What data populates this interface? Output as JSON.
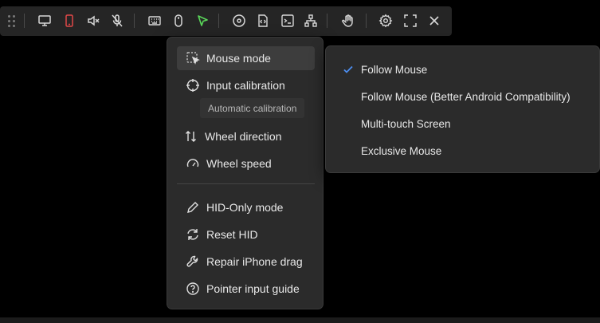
{
  "toolbar": {
    "icons": {
      "drag": "drag-handle-icon",
      "display": "monitor-icon",
      "phone": "phone-icon",
      "mute": "speaker-mute-icon",
      "mic": "microphone-off-icon",
      "keyboard": "keyboard-icon",
      "mouse": "mouse-icon",
      "pointer": "cursor-pointer-icon",
      "record": "disc-icon",
      "code": "code-file-icon",
      "terminal": "terminal-icon",
      "network": "network-icon",
      "hand": "hand-icon",
      "settings": "gear-icon",
      "fullscreen": "fullscreen-icon",
      "close": "close-icon"
    },
    "accent_red": "#e04848",
    "accent_green": "#5ad85a"
  },
  "menu": {
    "items": [
      {
        "label": "Mouse mode",
        "icon": "mouse-mode-icon"
      },
      {
        "label": "Input calibration",
        "icon": "crosshair-icon"
      },
      {
        "label": "Wheel direction",
        "icon": "wheel-direction-icon"
      },
      {
        "label": "Wheel speed",
        "icon": "speedometer-icon"
      },
      {
        "label": "HID-Only mode",
        "icon": "pencil-icon"
      },
      {
        "label": "Reset HID",
        "icon": "refresh-icon"
      },
      {
        "label": "Repair iPhone drag",
        "icon": "wrench-icon"
      },
      {
        "label": "Pointer input guide",
        "icon": "help-icon"
      }
    ],
    "tooltip": "Automatic calibration"
  },
  "submenu": {
    "items": [
      {
        "label": "Follow Mouse",
        "checked": true
      },
      {
        "label": "Follow Mouse (Better Android Compatibility)",
        "checked": false
      },
      {
        "label": "Multi-touch Screen",
        "checked": false
      },
      {
        "label": "Exclusive Mouse",
        "checked": false
      }
    ],
    "check_color": "#4c8ef0"
  }
}
